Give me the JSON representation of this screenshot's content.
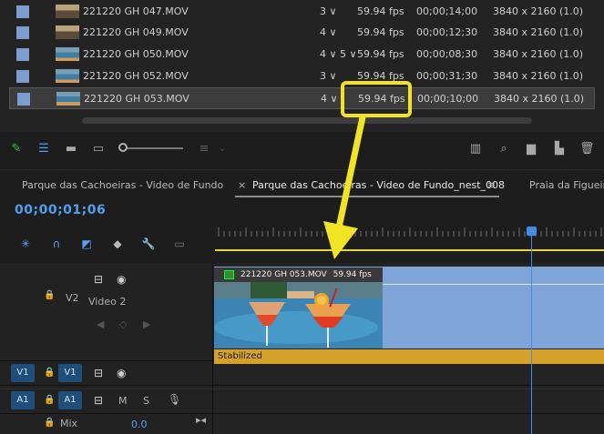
{
  "bin": {
    "rows": [
      {
        "name": "221220 GH 047.MOV",
        "channels": "3 ∨",
        "fps": "59.94 fps",
        "duration": "00;00;14;00",
        "resolution": "3840 x 2160 (1.0)",
        "thumb": "ocean",
        "selected": false
      },
      {
        "name": "221220 GH 049.MOV",
        "channels": "4 ∨",
        "fps": "59.94 fps",
        "duration": "00;00;12;30",
        "resolution": "3840 x 2160 (1.0)",
        "thumb": "ocean",
        "selected": false
      },
      {
        "name": "221220 GH 050.MOV",
        "channels": "4 ∨ 5 ∨",
        "fps": "59.94 fps",
        "duration": "00;00;08;30",
        "resolution": "3840 x 2160 (1.0)",
        "thumb": "pool",
        "selected": false
      },
      {
        "name": "221220 GH 052.MOV",
        "channels": "3 ∨",
        "fps": "59.94 fps",
        "duration": "00;00;31;30",
        "resolution": "3840 x 2160 (1.0)",
        "thumb": "pool",
        "selected": false
      },
      {
        "name": "221220 GH 053.MOV",
        "channels": "4 ∨",
        "fps": "59.94 fps",
        "duration": "00;00;10;00",
        "resolution": "3840 x 2160 (1.0)",
        "thumb": "pool",
        "selected": true
      }
    ]
  },
  "toolbar": {
    "icons": [
      "pencil-icon",
      "list-view-icon",
      "icon-view-icon",
      "freeform-view-icon",
      "zoom-slider",
      "sort-icon",
      "automate-to-sequence-icon",
      "find-icon",
      "new-bin-icon",
      "new-item-icon",
      "clear-icon"
    ]
  },
  "sequence": {
    "tabs": [
      {
        "label": "Parque das Cachoeiras - Video de Fundo",
        "active": false
      },
      {
        "label": "Parque das Cachoeiras - Video de Fundo_nest_008",
        "active": true
      },
      {
        "label": "Praia da Figueira",
        "active": false
      }
    ],
    "close_glyph": "×",
    "menu_glyph": "≡",
    "timecode": "00;00;01;06"
  },
  "tracks": {
    "v2": {
      "label": "V2",
      "name": "Video 2"
    },
    "v1": {
      "source": "V1",
      "target": "V1"
    },
    "a1": {
      "source": "A1",
      "target": "A1",
      "mute": "M",
      "solo": "S"
    },
    "mix": {
      "label": "Mix",
      "value": "0.0"
    }
  },
  "clip": {
    "name": "221220 GH 053.MOV",
    "fps": "59.94 fps",
    "effect": "Stabilized"
  },
  "colors": {
    "accent_blue": "#3f8ee8",
    "highlight_yellow": "#f1e422",
    "clip_blue": "#7ea4d8",
    "fx_orange": "#d6a12a",
    "timecode": "#4f9ff0"
  }
}
